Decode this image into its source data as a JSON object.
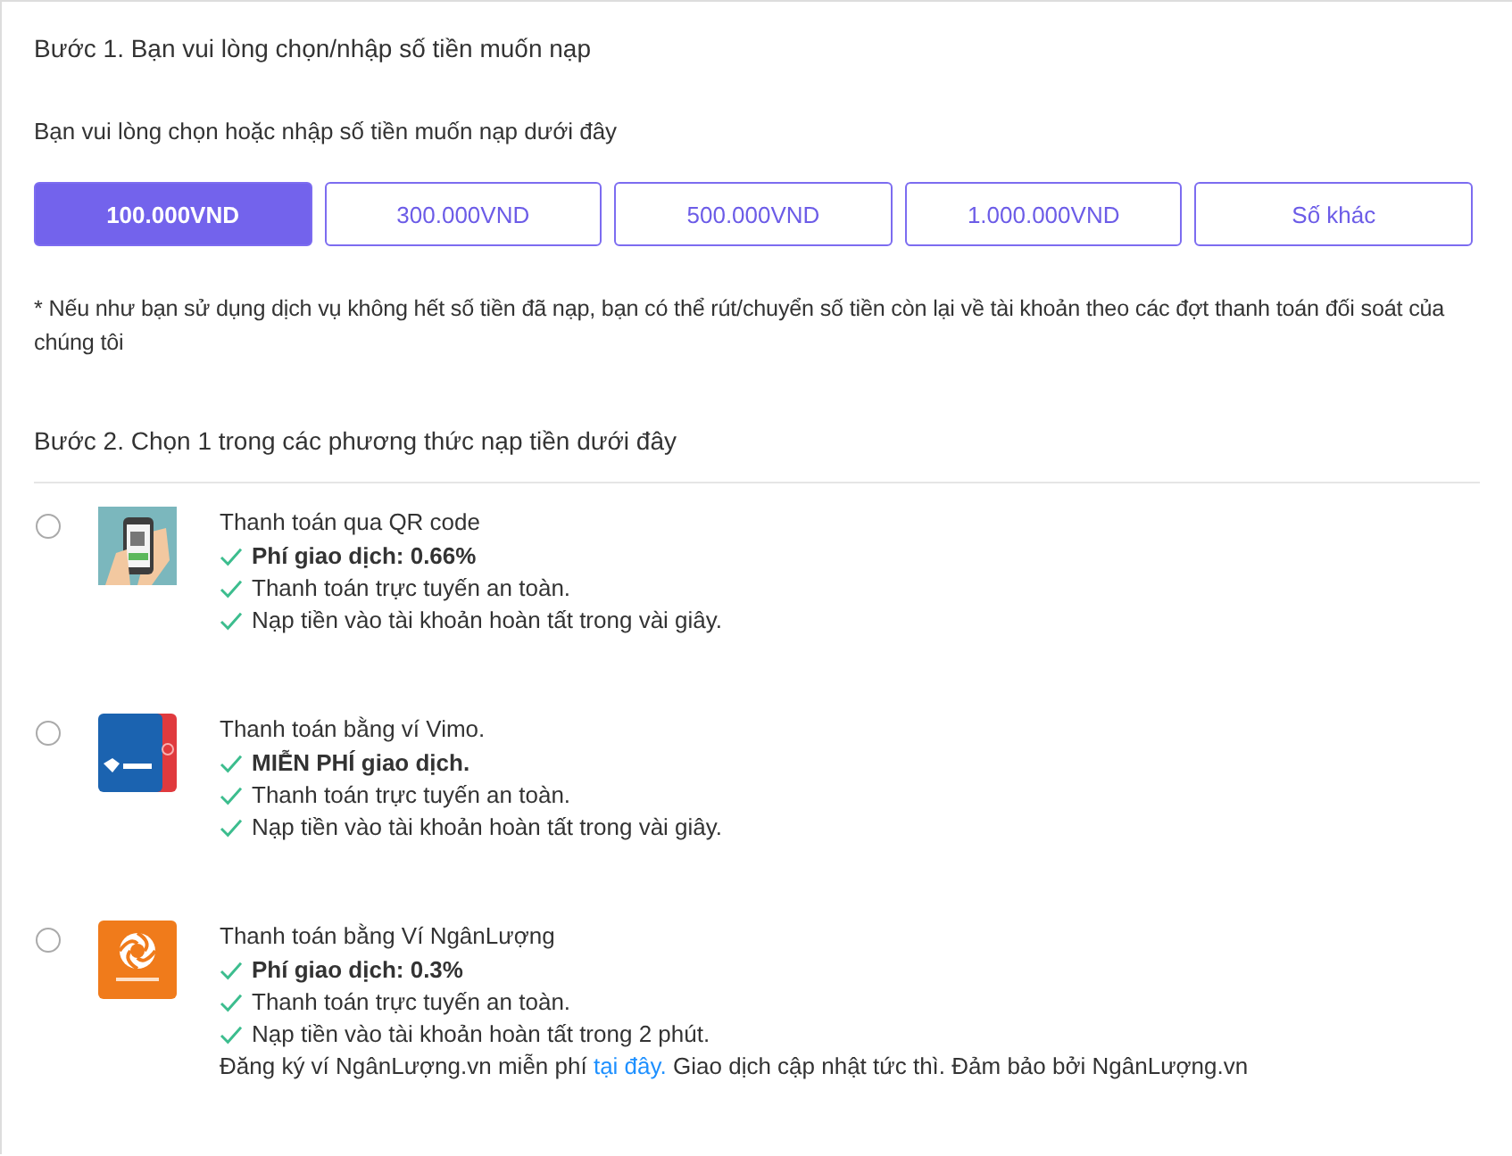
{
  "step1": {
    "title": "Bước 1. Bạn vui lòng chọn/nhập số tiền muốn nạp",
    "subtitle": "Bạn vui lòng chọn hoặc nhập số tiền muốn nạp dưới đây",
    "amounts": [
      {
        "label": "100.000VND",
        "selected": true
      },
      {
        "label": "300.000VND",
        "selected": false
      },
      {
        "label": "500.000VND",
        "selected": false
      },
      {
        "label": "1.000.000VND",
        "selected": false
      },
      {
        "label": "Số khác",
        "selected": false
      }
    ],
    "note": "* Nếu như bạn sử dụng dịch vụ không hết số tiền đã nạp, bạn có thể rút/chuyển số tiền còn lại về tài khoản theo các đợt thanh toán đối soát của chúng tôi"
  },
  "step2": {
    "title": "Bước 2. Chọn 1 trong các phương thức nạp tiền dưới đây",
    "methods": [
      {
        "kind": "qr",
        "selected": false,
        "title": "Thanh toán qua QR code",
        "features": [
          {
            "text": "Phí giao dịch: 0.66%",
            "bold": true
          },
          {
            "text": "Thanh toán trực tuyến an toàn.",
            "bold": false
          },
          {
            "text": "Nạp tiền vào tài khoản hoàn tất trong vài giây.",
            "bold": false
          }
        ]
      },
      {
        "kind": "vimo",
        "selected": false,
        "title": "Thanh toán bằng ví Vimo.",
        "features": [
          {
            "text": "MIỄN PHÍ giao dịch.",
            "bold": true
          },
          {
            "text": "Thanh toán trực tuyến an toàn.",
            "bold": false
          },
          {
            "text": "Nạp tiền vào tài khoản hoàn tất trong vài giây.",
            "bold": false
          }
        ]
      },
      {
        "kind": "nganluong",
        "selected": false,
        "title": "Thanh toán bằng Ví NgânLượng",
        "features": [
          {
            "text": "Phí giao dịch: 0.3%",
            "bold": true
          },
          {
            "text": "Thanh toán trực tuyến an toàn.",
            "bold": false
          },
          {
            "text": "Nạp tiền vào tài khoản hoàn tất trong 2 phút.",
            "bold": false
          }
        ],
        "note": {
          "before": "Đăng ký ví NgânLượng.vn miễn phí",
          "link": "tại đây.",
          "after": "Giao dịch cập nhật tức thì. Đảm bảo bởi NgânLượng.vn"
        }
      }
    ]
  }
}
